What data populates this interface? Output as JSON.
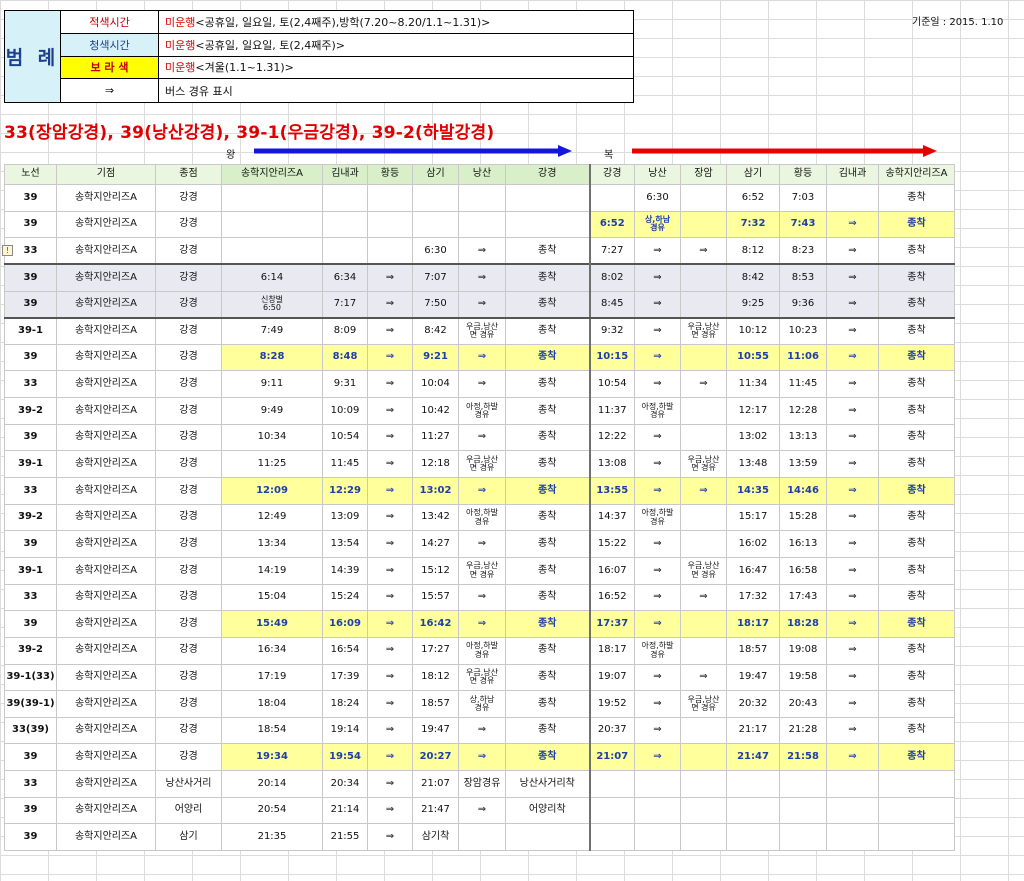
{
  "legend": {
    "title": "범 례",
    "rows": [
      {
        "label": "적색시간",
        "highlight": "미운행",
        "text": "<공휴일, 일요일, 토(2,4째주),방학(7.20~8.20/1.1~1.31)>"
      },
      {
        "label": "청색시간",
        "highlight": "미운행",
        "text": "<공휴일, 일요일, 토(2,4째주)>"
      },
      {
        "label": "보 라 색",
        "highlight": "미운행",
        "text": "<겨울(1.1~1.31)>"
      },
      {
        "label": "⇒",
        "highlight": "",
        "text": "버스 경유 표시"
      }
    ]
  },
  "std_date": "기준일 : 2015. 1.10",
  "title": "33(장암강경), 39(낭산강경), 39-1(우금강경), 39-2(하발강경)",
  "dir_out": "왕",
  "dir_in": "복",
  "colors": {
    "arrow_out": "#1515e0",
    "arrow_in": "#e80000",
    "highlight_row": "#ffff9b",
    "title": "#e00000"
  },
  "headers": [
    "노선",
    "기점",
    "종점",
    "송학지안리즈A",
    "김내과",
    "황등",
    "삼기",
    "낭산",
    "강경",
    "강경",
    "낭산",
    "장암",
    "삼기",
    "황등",
    "김내과",
    "송학지안리즈A"
  ],
  "rows": [
    {
      "c": [
        "39",
        "송학지안리즈A",
        "강경",
        "",
        "",
        "",
        "",
        "",
        "",
        "",
        "6:30",
        "",
        "6:52",
        "7:03",
        "",
        "종착"
      ]
    },
    {
      "c": [
        "39",
        "송학지안리즈A",
        "강경",
        "",
        "",
        "",
        "",
        "",
        "",
        "6:52",
        "상,하남\n경유",
        "",
        "7:32",
        "7:43",
        "⇒",
        "종착"
      ],
      "partial": true
    },
    {
      "c": [
        "33",
        "송학지안리즈A",
        "강경",
        "",
        "",
        "",
        "6:30",
        "⇒",
        "종착",
        "7:27",
        "⇒",
        "⇒",
        "8:12",
        "8:23",
        "⇒",
        "종착"
      ]
    },
    {
      "c": [
        "39",
        "송학지안리즈A",
        "강경",
        "6:14",
        "6:34",
        "⇒",
        "7:07",
        "⇒",
        "종착",
        "8:02",
        "⇒",
        "",
        "8:42",
        "8:53",
        "⇒",
        "종착"
      ],
      "grey": 1
    },
    {
      "c": [
        "39",
        "송학지안리즈A",
        "강경",
        "신창벌\n6:50",
        "7:17",
        "⇒",
        "7:50",
        "⇒",
        "종착",
        "8:45",
        "⇒",
        "",
        "9:25",
        "9:36",
        "⇒",
        "종착"
      ],
      "grey": 2
    },
    {
      "c": [
        "39-1",
        "송학지안리즈A",
        "강경",
        "7:49",
        "8:09",
        "⇒",
        "8:42",
        "우금,낭산\n면 경유",
        "종착",
        "9:32",
        "⇒",
        "우금,낭산\n면 경유",
        "10:12",
        "10:23",
        "⇒",
        "종착"
      ]
    },
    {
      "c": [
        "39",
        "송학지안리즈A",
        "강경",
        "8:28",
        "8:48",
        "⇒",
        "9:21",
        "⇒",
        "종착",
        "10:15",
        "⇒",
        "",
        "10:55",
        "11:06",
        "⇒",
        "종착"
      ],
      "hl": true
    },
    {
      "c": [
        "33",
        "송학지안리즈A",
        "강경",
        "9:11",
        "9:31",
        "⇒",
        "10:04",
        "⇒",
        "종착",
        "10:54",
        "⇒",
        "⇒",
        "11:34",
        "11:45",
        "⇒",
        "종착"
      ]
    },
    {
      "c": [
        "39-2",
        "송학지안리즈A",
        "강경",
        "9:49",
        "10:09",
        "⇒",
        "10:42",
        "아정,하발\n경유",
        "종착",
        "11:37",
        "아정,하발\n경유",
        "",
        "12:17",
        "12:28",
        "⇒",
        "종착"
      ]
    },
    {
      "c": [
        "39",
        "송학지안리즈A",
        "강경",
        "10:34",
        "10:54",
        "⇒",
        "11:27",
        "⇒",
        "종착",
        "12:22",
        "⇒",
        "",
        "13:02",
        "13:13",
        "⇒",
        "종착"
      ]
    },
    {
      "c": [
        "39-1",
        "송학지안리즈A",
        "강경",
        "11:25",
        "11:45",
        "⇒",
        "12:18",
        "우금,낭산\n면 경유",
        "종착",
        "13:08",
        "⇒",
        "우금,낭산\n면 경유",
        "13:48",
        "13:59",
        "⇒",
        "종착"
      ]
    },
    {
      "c": [
        "33",
        "송학지안리즈A",
        "강경",
        "12:09",
        "12:29",
        "⇒",
        "13:02",
        "⇒",
        "종착",
        "13:55",
        "⇒",
        "⇒",
        "14:35",
        "14:46",
        "⇒",
        "종착"
      ],
      "hl": true
    },
    {
      "c": [
        "39-2",
        "송학지안리즈A",
        "강경",
        "12:49",
        "13:09",
        "⇒",
        "13:42",
        "아정,하발\n경유",
        "종착",
        "14:37",
        "아정,하발\n경유",
        "",
        "15:17",
        "15:28",
        "⇒",
        "종착"
      ]
    },
    {
      "c": [
        "39",
        "송학지안리즈A",
        "강경",
        "13:34",
        "13:54",
        "⇒",
        "14:27",
        "⇒",
        "종착",
        "15:22",
        "⇒",
        "",
        "16:02",
        "16:13",
        "⇒",
        "종착"
      ]
    },
    {
      "c": [
        "39-1",
        "송학지안리즈A",
        "강경",
        "14:19",
        "14:39",
        "⇒",
        "15:12",
        "우금,낭산\n면 경유",
        "종착",
        "16:07",
        "⇒",
        "우금,낭산\n면 경유",
        "16:47",
        "16:58",
        "⇒",
        "종착"
      ]
    },
    {
      "c": [
        "33",
        "송학지안리즈A",
        "강경",
        "15:04",
        "15:24",
        "⇒",
        "15:57",
        "⇒",
        "종착",
        "16:52",
        "⇒",
        "⇒",
        "17:32",
        "17:43",
        "⇒",
        "종착"
      ]
    },
    {
      "c": [
        "39",
        "송학지안리즈A",
        "강경",
        "15:49",
        "16:09",
        "⇒",
        "16:42",
        "⇒",
        "종착",
        "17:37",
        "⇒",
        "",
        "18:17",
        "18:28",
        "⇒",
        "종착"
      ],
      "hl": true
    },
    {
      "c": [
        "39-2",
        "송학지안리즈A",
        "강경",
        "16:34",
        "16:54",
        "⇒",
        "17:27",
        "아정,하발\n경유",
        "종착",
        "18:17",
        "아정,하발\n경유",
        "",
        "18:57",
        "19:08",
        "⇒",
        "종착"
      ]
    },
    {
      "c": [
        "39-1(33)",
        "송학지안리즈A",
        "강경",
        "17:19",
        "17:39",
        "⇒",
        "18:12",
        "우금,낭산\n면 경유",
        "종착",
        "19:07",
        "⇒",
        "⇒",
        "19:47",
        "19:58",
        "⇒",
        "종착"
      ]
    },
    {
      "c": [
        "39(39-1)",
        "송학지안리즈A",
        "강경",
        "18:04",
        "18:24",
        "⇒",
        "18:57",
        "상,하남\n경유",
        "종착",
        "19:52",
        "⇒",
        "우금,낭산\n면 경유",
        "20:32",
        "20:43",
        "⇒",
        "종착"
      ]
    },
    {
      "c": [
        "33(39)",
        "송학지안리즈A",
        "강경",
        "18:54",
        "19:14",
        "⇒",
        "19:47",
        "⇒",
        "종착",
        "20:37",
        "⇒",
        "",
        "21:17",
        "21:28",
        "⇒",
        "종착"
      ]
    },
    {
      "c": [
        "39",
        "송학지안리즈A",
        "강경",
        "19:34",
        "19:54",
        "⇒",
        "20:27",
        "⇒",
        "종착",
        "21:07",
        "⇒",
        "",
        "21:47",
        "21:58",
        "⇒",
        "종착"
      ],
      "hl": true
    },
    {
      "c": [
        "33",
        "송학지안리즈A",
        "낭산사거리",
        "20:14",
        "20:34",
        "⇒",
        "21:07",
        "장암경유",
        "낭산사거리착",
        "",
        "",
        "",
        "",
        "",
        "",
        ""
      ],
      "short": true
    },
    {
      "c": [
        "39",
        "송학지안리즈A",
        "어양리",
        "20:54",
        "21:14",
        "⇒",
        "21:47",
        "⇒",
        "어양리착",
        "",
        "",
        "",
        "",
        "",
        "",
        ""
      ],
      "short": true
    },
    {
      "c": [
        "39",
        "송학지안리즈A",
        "삼기",
        "21:35",
        "21:55",
        "⇒",
        "삼기착",
        "",
        "",
        "",
        "",
        "",
        "",
        "",
        "",
        ""
      ],
      "short": true
    }
  ]
}
